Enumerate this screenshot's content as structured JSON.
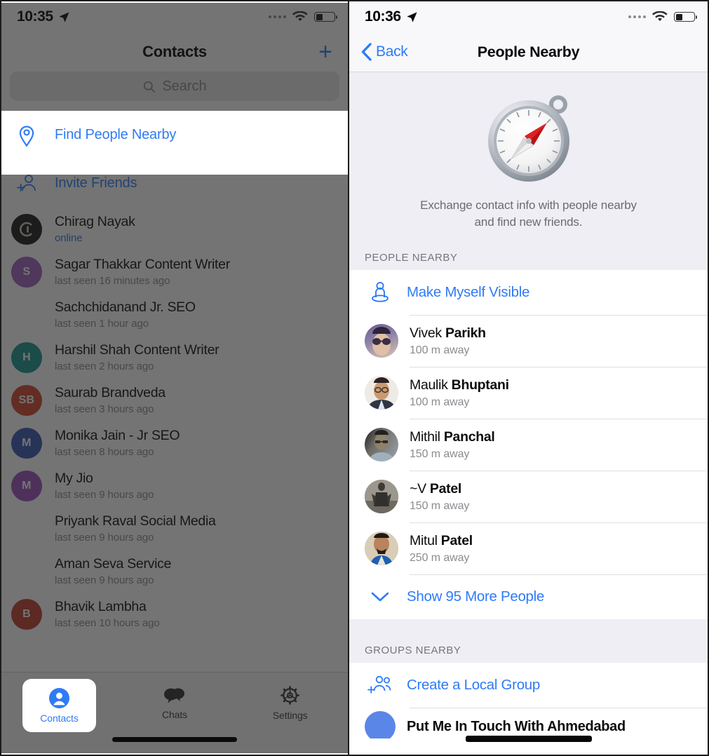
{
  "left": {
    "status": {
      "time": "10:35",
      "location_icon": "location-arrow-icon",
      "wifi_icon": "wifi-icon",
      "battery_icon": "battery-icon"
    },
    "nav": {
      "title": "Contacts",
      "add_icon": "plus-icon"
    },
    "search": {
      "placeholder": "Search",
      "icon": "search-icon"
    },
    "highlight_row": {
      "label": "Find People Nearby",
      "icon": "location-pin-icon"
    },
    "invite_row": {
      "label": "Invite Friends",
      "icon": "person-add-icon"
    },
    "contacts": [
      {
        "name": "Chirag Nayak",
        "status": "online",
        "online": true,
        "initials": "G",
        "color": "#1a1a1a"
      },
      {
        "name": "Sagar Thakkar Content Writer",
        "status": "last seen 16 minutes ago",
        "online": false,
        "initials": "S",
        "color": "#a05fc0"
      },
      {
        "name": "Sachchidanand Jr. SEO",
        "status": "last seen 1 hour ago",
        "online": false,
        "initials": "",
        "color": ""
      },
      {
        "name": "Harshil Shah Content Writer",
        "status": "last seen 2 hours ago",
        "online": false,
        "initials": "H",
        "color": "#16968f"
      },
      {
        "name": "Saurab Brandveda",
        "status": "last seen 3 hours ago",
        "online": false,
        "initials": "SB",
        "color": "#d1462f"
      },
      {
        "name": "Monika Jain - Jr SEO",
        "status": "last seen 8 hours ago",
        "online": false,
        "initials": "M",
        "color": "#3756b5"
      },
      {
        "name": "My Jio",
        "status": "last seen 9 hours ago",
        "online": false,
        "initials": "M",
        "color": "#9b4fbb"
      },
      {
        "name": "Priyank Raval Social Media",
        "status": "last seen 9 hours ago",
        "online": false,
        "initials": "",
        "color": ""
      },
      {
        "name": "Aman Seva Service",
        "status": "last seen 9 hours ago",
        "online": false,
        "initials": "",
        "color": ""
      },
      {
        "name": "Bhavik Lambha",
        "status": "last seen 10 hours ago",
        "online": false,
        "initials": "B",
        "color": "#c13c2c"
      }
    ],
    "tabs": [
      {
        "label": "Contacts",
        "icon": "contacts-person-icon",
        "active": true
      },
      {
        "label": "Chats",
        "icon": "chat-bubbles-icon",
        "active": false
      },
      {
        "label": "Settings",
        "icon": "gear-icon",
        "active": false
      }
    ]
  },
  "right": {
    "status": {
      "time": "10:36",
      "location_icon": "location-arrow-icon",
      "wifi_icon": "wifi-icon",
      "battery_icon": "battery-icon"
    },
    "nav": {
      "back_label": "Back",
      "back_icon": "chevron-left-icon",
      "title": "People Nearby"
    },
    "hero": {
      "illustration": "compass-icon",
      "description_line1": "Exchange contact info with people nearby",
      "description_line2": "and find new friends."
    },
    "people_section": {
      "header": "PEOPLE NEARBY",
      "make_visible": {
        "label": "Make Myself Visible",
        "icon": "person-visible-icon"
      },
      "people": [
        {
          "first": "Vivek ",
          "last": "Parikh",
          "distance": "100 m away",
          "avatar_top": "#6f5b8e",
          "avatar_bottom": "#d6c6b2"
        },
        {
          "first": "Maulik ",
          "last": "Bhuptani",
          "distance": "100 m away",
          "avatar_top": "#e8e4e0",
          "avatar_bottom": "#3a3f52"
        },
        {
          "first": "Mithil ",
          "last": "Panchal",
          "distance": "150 m away",
          "avatar_top": "#6d6b66",
          "avatar_bottom": "#8b949c"
        },
        {
          "first": "~V ",
          "last": "Patel",
          "distance": "150 m away",
          "avatar_top": "#8e8b84",
          "avatar_bottom": "#5c574f"
        },
        {
          "first": "Mitul ",
          "last": "Patel",
          "distance": "250 m away",
          "avatar_top": "#c9b19a",
          "avatar_bottom": "#2a5fa8"
        }
      ],
      "show_more": {
        "label": "Show 95 More People",
        "icon": "chevron-down-icon"
      }
    },
    "groups_section": {
      "header": "GROUPS NEARBY",
      "create_group": {
        "label": "Create a Local Group",
        "icon": "group-add-icon"
      },
      "first_group": {
        "name": "Put Me In Touch With Ahmedabad",
        "avatar_color": "#5a86e8"
      }
    }
  },
  "colors": {
    "accent": "#2f7bf6",
    "dim_overlay": "#1e1e1e",
    "section_bg": "#eeeef4"
  }
}
